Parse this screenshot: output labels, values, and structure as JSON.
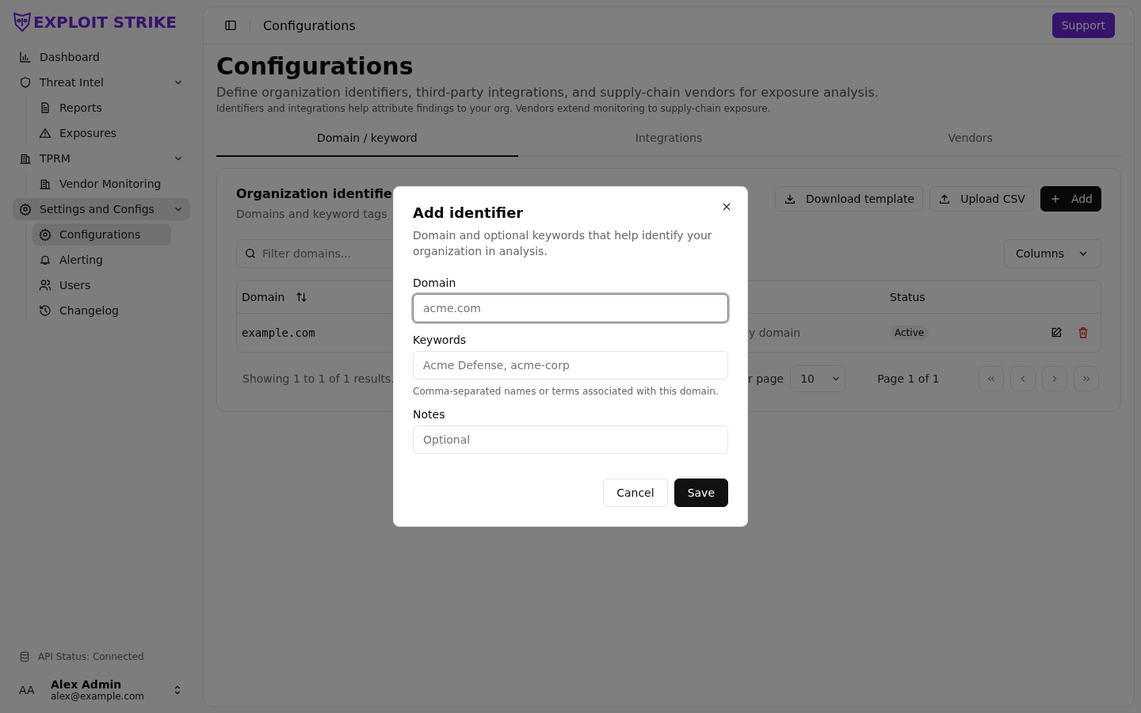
{
  "brand": {
    "name": "EXPLOIT STRIKE"
  },
  "sidebar": {
    "items": [
      {
        "label": "Dashboard",
        "selected": false
      },
      {
        "label": "Threat Intel",
        "selected": false,
        "expanded": true,
        "children": [
          {
            "label": "Reports",
            "selected": false
          },
          {
            "label": "Exposures",
            "selected": false
          }
        ]
      },
      {
        "label": "TPRM",
        "selected": false,
        "expanded": true,
        "children": [
          {
            "label": "Vendor Monitoring",
            "selected": false
          }
        ]
      },
      {
        "label": "Settings and Configs",
        "selected": true,
        "expanded": true,
        "children": [
          {
            "label": "Configurations",
            "selected": true
          },
          {
            "label": "Alerting",
            "selected": false
          },
          {
            "label": "Users",
            "selected": false
          },
          {
            "label": "Changelog",
            "selected": false
          }
        ]
      }
    ],
    "api_status": "API Status: Connected",
    "user": {
      "initials": "AA",
      "name": "Alex Admin",
      "email": "alex@example.com"
    }
  },
  "header": {
    "breadcrumb": "Configurations",
    "support_button": "Support"
  },
  "page": {
    "title": "Configurations",
    "subtitle": "Define organization identifiers, third-party integrations, and supply-chain vendors for exposure analysis.",
    "note": "Identifiers and integrations help attribute findings to your org. Vendors extend monitoring to supply-chain exposure."
  },
  "tabs": [
    {
      "label": "Domain / keyword",
      "selected": true
    },
    {
      "label": "Integrations",
      "selected": false
    },
    {
      "label": "Vendors",
      "selected": false
    }
  ],
  "card": {
    "title": "Organization identifie",
    "description": "Domains and keyword tags",
    "buttons": [
      "Download template",
      "Upload CSV",
      "Add"
    ],
    "filter_placeholder": "Filter domains...",
    "columns_button": "Columns",
    "table": {
      "columns": [
        "Domain",
        "",
        "Status"
      ],
      "rows": [
        {
          "domain": "example.com",
          "column_2": "y domain",
          "status": "Active"
        }
      ]
    },
    "pagination": {
      "summary": "Showing 1 to 1 of 1 results.",
      "rows_per_page_label": "r page",
      "rows_per_page": "10",
      "page": "Page 1 of 1"
    }
  },
  "dialog": {
    "title": "Add identifier",
    "description": "Domain and optional keywords that help identify your organization in analysis.",
    "fields": [
      {
        "label": "Domain",
        "placeholder": "acme.com",
        "focused": true
      },
      {
        "label": "Keywords",
        "placeholder": "Acme Defense, acme-corp",
        "hint": "Comma-separated names or terms associated with this domain.",
        "focused": false
      },
      {
        "label": "Notes",
        "placeholder": "Optional",
        "focused": false
      }
    ],
    "buttons": [
      "Cancel",
      "Save"
    ]
  }
}
